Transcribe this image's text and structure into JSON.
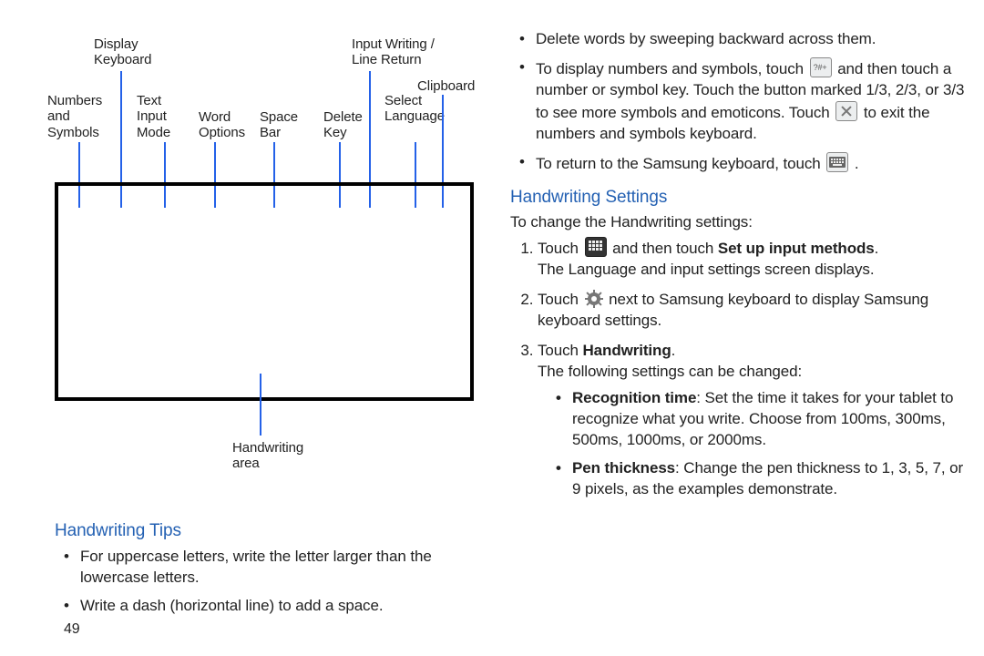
{
  "pageNumber": "49",
  "left": {
    "diagram": {
      "labels": {
        "displayKeyboard": "Display\nKeyboard",
        "inputWriting": "Input Writing /\nLine Return",
        "clipboard": "Clipboard",
        "numbersSymbols": "Numbers\nand\nSymbols",
        "textInputMode": "Text\nInput\nMode",
        "wordOptions": "Word\nOptions",
        "spaceBar": "Space\nBar",
        "deleteKey": "Delete\nKey",
        "selectLanguage": "Select\nLanguage",
        "handwritingArea": "Handwriting\narea"
      }
    },
    "sectionTitle": "Handwriting Tips",
    "tips": [
      "For uppercase letters, write the letter larger than the lowercase letters.",
      "Write a dash (horizontal line) to add a space."
    ]
  },
  "right": {
    "topBullets": {
      "b1": "Delete words by sweeping backward across them.",
      "b2a": "To display numbers and symbols, touch ",
      "b2b": " and then touch a number or symbol key. Touch the button marked 1/3, 2/3, or 3/3 to see more symbols and emoticons. Touch ",
      "b2c": " to exit the numbers and symbols keyboard.",
      "b3a": "To return to the Samsung keyboard, touch ",
      "b3b": "."
    },
    "sectionTitle": "Handwriting Settings",
    "intro": "To change the Handwriting settings:",
    "steps": {
      "s1a": "Touch ",
      "s1b": " and then touch ",
      "s1bold": "Set up input methods",
      "s1c": ".",
      "s1line2": "The Language and input settings screen displays.",
      "s2a": "Touch ",
      "s2b": " next to Samsung keyboard to display Samsung keyboard settings.",
      "s3a": "Touch ",
      "s3bold": "Handwriting",
      "s3b": ".",
      "s3line2": "The following settings can be changed:"
    },
    "settings": {
      "rt_label": "Recognition time",
      "rt_text": ": Set the time it takes for your tablet to recognize what you write. Choose from 100ms, 300ms, 500ms, 1000ms, or 2000ms.",
      "pt_label": "Pen thickness",
      "pt_text": ": Change the pen thickness to 1, 3, 5, 7, or 9 pixels, as the examples demonstrate."
    }
  }
}
